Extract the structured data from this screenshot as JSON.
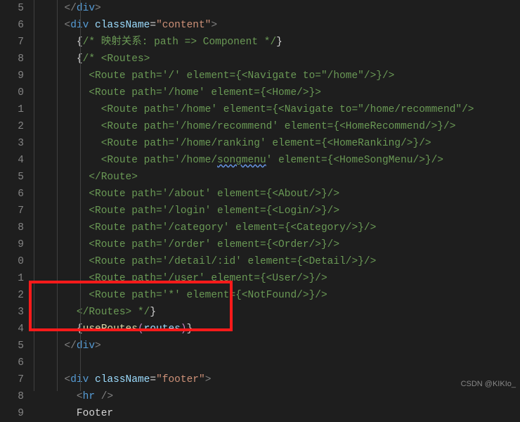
{
  "gutter": {
    "start": 5,
    "count": 25,
    "active": 37
  },
  "code_lines": [
    [
      [
        "plain",
        "     "
      ],
      [
        "bracket",
        "</"
      ],
      [
        "tag",
        "div"
      ],
      [
        "bracket",
        ">"
      ]
    ],
    [
      [
        "plain",
        "     "
      ],
      [
        "bracket",
        "<"
      ],
      [
        "tag",
        "div"
      ],
      [
        "plain",
        " "
      ],
      [
        "attr",
        "className"
      ],
      [
        "op",
        "="
      ],
      [
        "str",
        "\"content\""
      ],
      [
        "bracket",
        ">"
      ]
    ],
    [
      [
        "plain",
        "       "
      ],
      [
        "brace",
        "{"
      ],
      [
        "cmt",
        "/* 映射关系: path => Component */"
      ],
      [
        "brace",
        "}"
      ]
    ],
    [
      [
        "plain",
        "       "
      ],
      [
        "brace",
        "{"
      ],
      [
        "cmt",
        "/* <Routes>"
      ]
    ],
    [
      [
        "cmt",
        "         <Route path='/' element={<Navigate to=\"/home\"/>}/>"
      ]
    ],
    [
      [
        "cmt",
        "         <Route path='/home' element={<Home/>}>"
      ]
    ],
    [
      [
        "cmt",
        "           <Route path='/home' element={<Navigate to=\"/home/recommend\"/>"
      ]
    ],
    [
      [
        "cmt",
        "           <Route path='/home/recommend' element={<HomeRecommend/>}/>"
      ]
    ],
    [
      [
        "cmt",
        "           <Route path='/home/ranking' element={<HomeRanking/>}/>"
      ]
    ],
    [
      [
        "cmt",
        "           <Route path='/home/"
      ],
      [
        "cmt wavy",
        "songmenu"
      ],
      [
        "cmt",
        "' element={<HomeSongMenu/>}/>"
      ]
    ],
    [
      [
        "cmt",
        "         </Route>"
      ]
    ],
    [
      [
        "cmt",
        "         <Route path='/about' element={<About/>}/>"
      ]
    ],
    [
      [
        "cmt",
        "         <Route path='/login' element={<Login/>}/>"
      ]
    ],
    [
      [
        "cmt",
        "         <Route path='/category' element={<Category/>}/>"
      ]
    ],
    [
      [
        "cmt",
        "         <Route path='/order' element={<Order/>}/>"
      ]
    ],
    [
      [
        "cmt",
        "         <Route path='/detail/:id' element={<Detail/>}/>"
      ]
    ],
    [
      [
        "cmt",
        "         <Route path='/user' element={<User/>}/>"
      ]
    ],
    [
      [
        "cmt",
        "         <Route path='*' element={<NotFound/>}/>"
      ]
    ],
    [
      [
        "cmt",
        "       </Routes> */"
      ],
      [
        "brace",
        "}"
      ]
    ],
    [
      [
        "plain",
        "       "
      ],
      [
        "brace",
        "{"
      ],
      [
        "func",
        "useRoutes"
      ],
      [
        "paren",
        "("
      ],
      [
        "var",
        "routes"
      ],
      [
        "paren",
        ")"
      ],
      [
        "brace",
        "}"
      ]
    ],
    [
      [
        "plain",
        "     "
      ],
      [
        "bracket",
        "</"
      ],
      [
        "tag",
        "div"
      ],
      [
        "bracket",
        ">"
      ]
    ],
    [
      [
        "plain",
        ""
      ]
    ],
    [
      [
        "plain",
        "     "
      ],
      [
        "bracket",
        "<"
      ],
      [
        "tag",
        "div"
      ],
      [
        "plain",
        " "
      ],
      [
        "attr",
        "className"
      ],
      [
        "op",
        "="
      ],
      [
        "str",
        "\"footer\""
      ],
      [
        "bracket",
        ">"
      ]
    ],
    [
      [
        "plain",
        "       "
      ],
      [
        "bracket",
        "<"
      ],
      [
        "tag",
        "hr"
      ],
      [
        "plain",
        " "
      ],
      [
        "bracket",
        "/>"
      ]
    ],
    [
      [
        "plain",
        "       Footer"
      ]
    ]
  ],
  "watermark": "CSDN @KIKIo_"
}
